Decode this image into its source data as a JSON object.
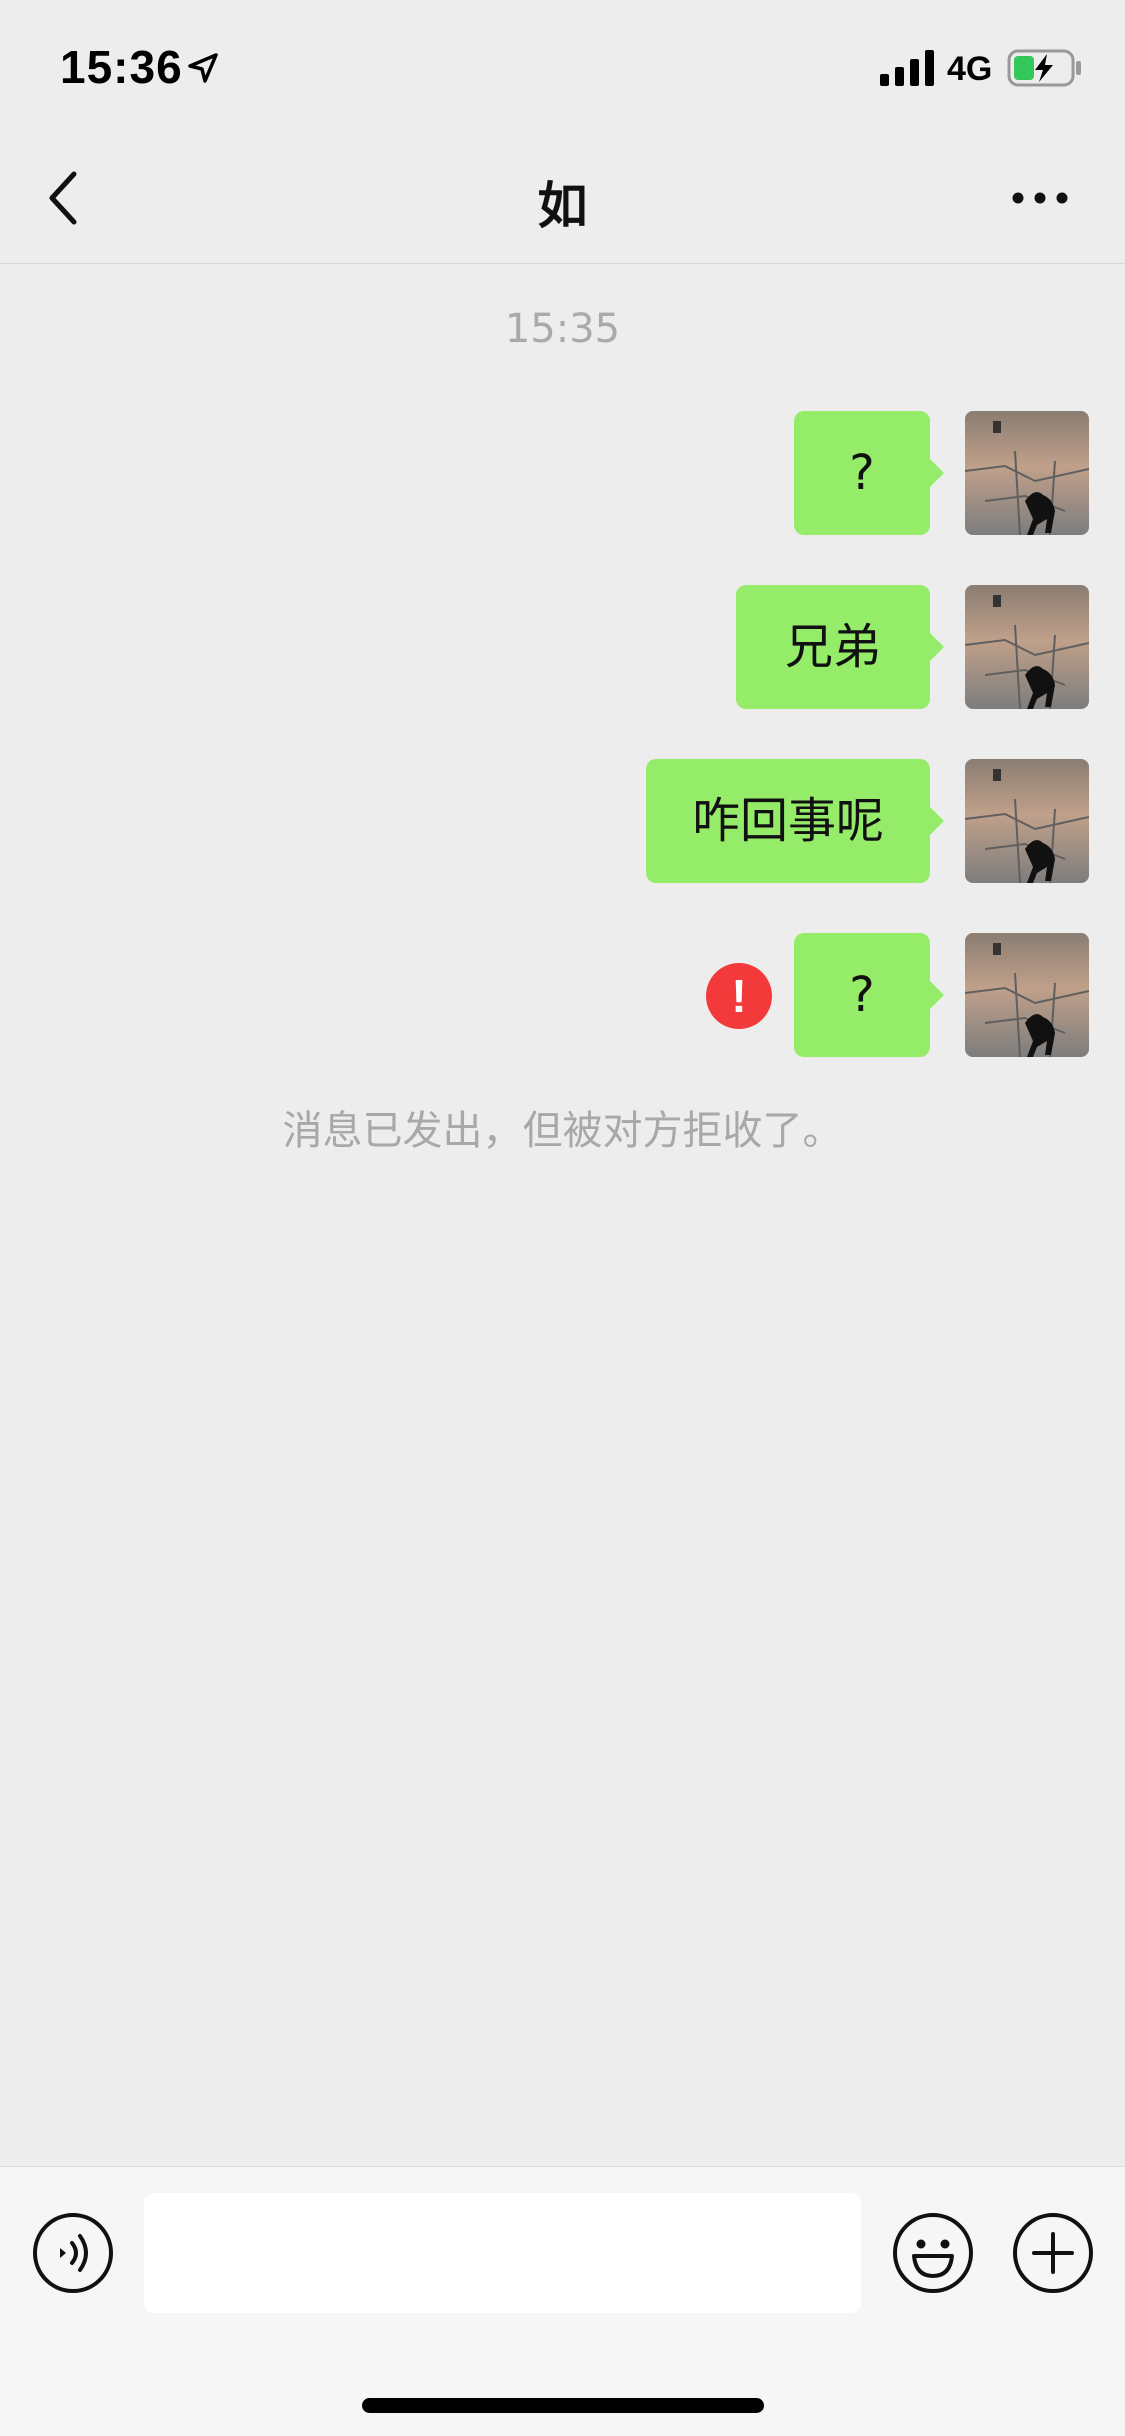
{
  "status_bar": {
    "time": "15:36",
    "network": "4G",
    "icons": [
      "location-arrow-icon",
      "signal-icon",
      "battery-charging-icon"
    ]
  },
  "nav": {
    "title": "如",
    "back_icon": "chevron-left-icon",
    "more_icon": "more-dots-icon"
  },
  "chat": {
    "timestamp": "15:35",
    "messages": [
      {
        "text": "?",
        "from": "self",
        "status": "sent"
      },
      {
        "text": "兄弟",
        "from": "self",
        "status": "sent"
      },
      {
        "text": "咋回事呢",
        "from": "self",
        "status": "sent"
      },
      {
        "text": "?",
        "from": "self",
        "status": "failed"
      }
    ],
    "failed_mark": "!",
    "system_notice": "消息已发出，但被对方拒收了。"
  },
  "input_bar": {
    "voice_icon": "voice-icon",
    "emoji_icon": "emoji-icon",
    "plus_icon": "plus-icon",
    "input_value": ""
  },
  "colors": {
    "bubble_self": "#95ec69",
    "background": "#ededed",
    "error": "#f23a3a",
    "notice_text": "#a8a8a8"
  }
}
